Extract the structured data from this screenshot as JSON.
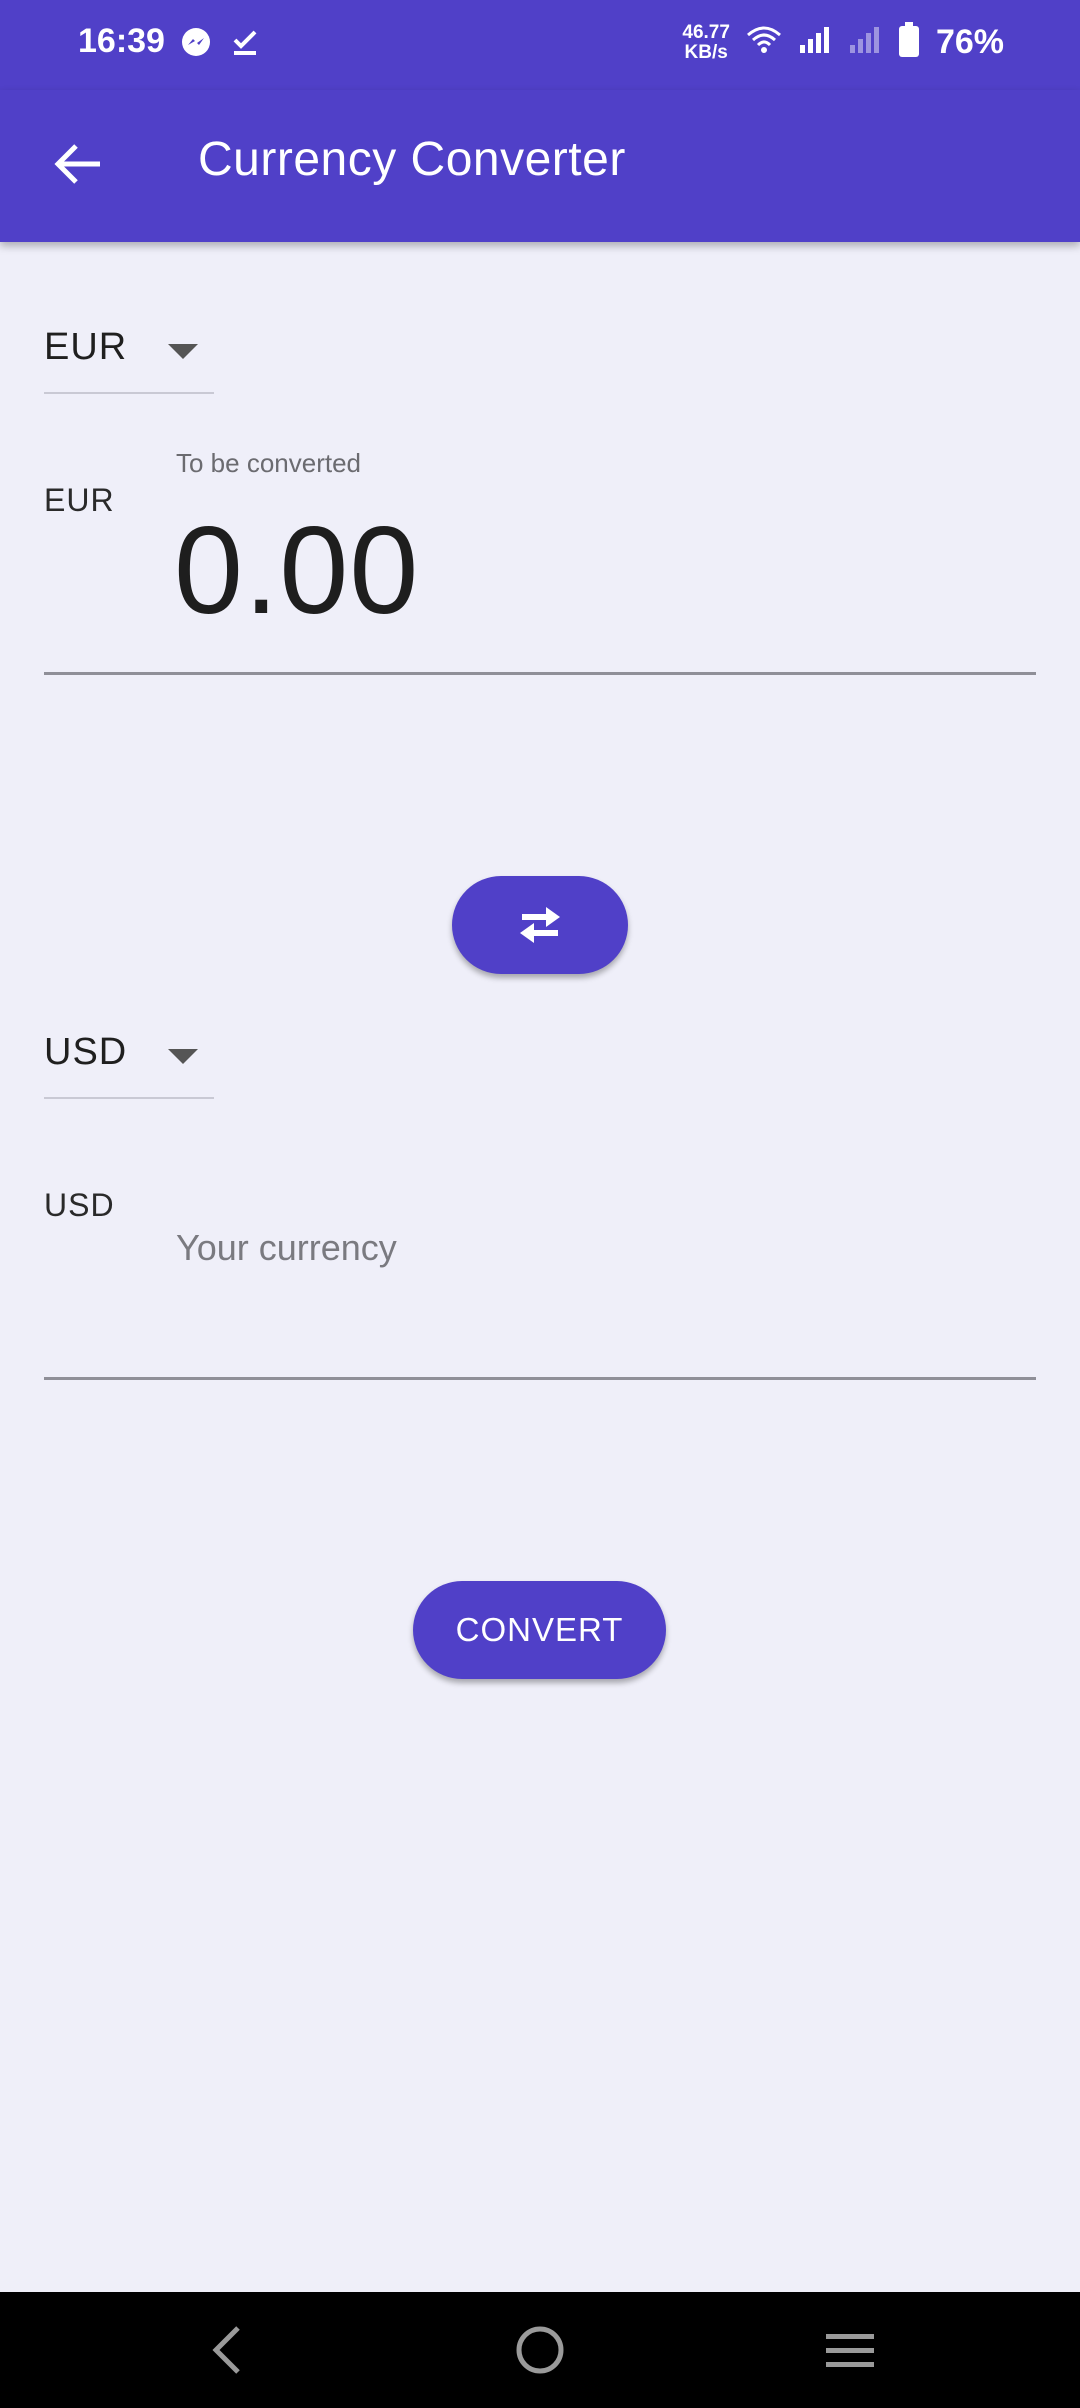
{
  "status_bar": {
    "time": "16:39",
    "net_speed_value": "46.77",
    "net_speed_unit": "KB/s",
    "battery": "76%",
    "icons": [
      "messenger-icon",
      "task-done-icon",
      "wifi-icon",
      "signal-icon",
      "signal-weak-icon",
      "battery-icon"
    ]
  },
  "app_bar": {
    "title": "Currency Converter",
    "back_icon": "arrow-back-icon"
  },
  "from": {
    "currency": "EUR",
    "prefix": "EUR",
    "label": "To be converted",
    "value": "0.00"
  },
  "swap": {
    "icon": "swap-horizontal-icon"
  },
  "to": {
    "currency": "USD",
    "prefix": "USD",
    "placeholder": "Your currency"
  },
  "actions": {
    "convert_label": "CONVERT"
  },
  "nav": {
    "icons": [
      "nav-back-icon",
      "nav-home-icon",
      "nav-menu-icon"
    ]
  },
  "colors": {
    "primary": "#5040c8",
    "background": "#efeff9",
    "nav_bar": "#000000"
  }
}
